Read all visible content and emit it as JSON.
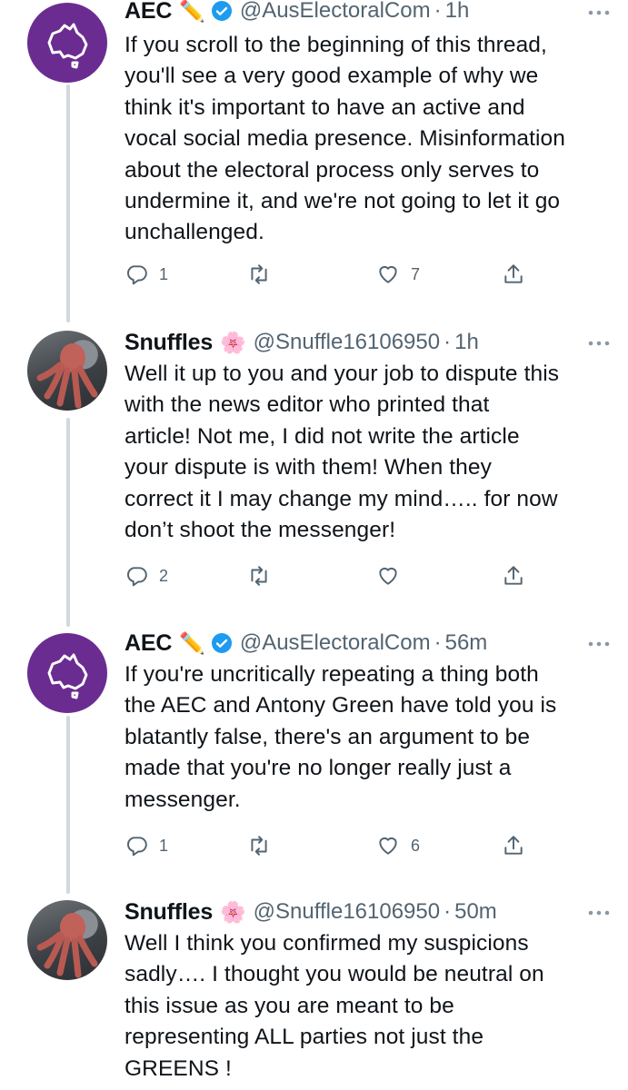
{
  "tweets": [
    {
      "name": "AEC",
      "emoji": "✏️",
      "verified": true,
      "handle": "@AusElectoralCom",
      "time": "1h",
      "body": "If you scroll to the beginning of this thread,\nyou'll see a very good example of why we\nthink it's important to have an active and\nvocal social media presence. Misinformation\nabout the electoral process only serves to\nundermine it, and we're not going to let it go\nunchallenged.",
      "replies": "1",
      "retweets": "",
      "likes": "7"
    },
    {
      "name": "Snuffles",
      "emoji": "🌸",
      "verified": false,
      "handle": "@Snuffle16106950",
      "time": "1h",
      "body": "Well it up to you and your job to dispute this\nwith the news editor who printed that\narticle! Not me, I did not write the article\nyour dispute is with them! When they\ncorrect it I may change my mind….. for now\ndon’t shoot the messenger!",
      "replies": "2",
      "retweets": "",
      "likes": ""
    },
    {
      "name": "AEC",
      "emoji": "✏️",
      "verified": true,
      "handle": "@AusElectoralCom",
      "time": "56m",
      "body": "If you're uncritically repeating a thing both\nthe AEC and Antony Green have told you is\nblatantly false, there's an argument to be\nmade that you're no longer really just a\nmessenger.",
      "replies": "1",
      "retweets": "",
      "likes": "6"
    },
    {
      "name": "Snuffles",
      "emoji": "🌸",
      "verified": false,
      "handle": "@Snuffle16106950",
      "time": "50m",
      "body": "Well I think you confirmed my suspicions\nsadly…. I thought you would be neutral on\nthis issue  as you are meant to be\nrepresenting ALL parties not just the\nGREENS !",
      "replies": "",
      "retweets": "",
      "likes": ""
    }
  ],
  "separator": "·",
  "colors": {
    "aec_purple": "#6a2c91",
    "verified_blue": "#1d9bf0",
    "secondary_text": "#536471",
    "thread_line": "#cfd9de"
  }
}
